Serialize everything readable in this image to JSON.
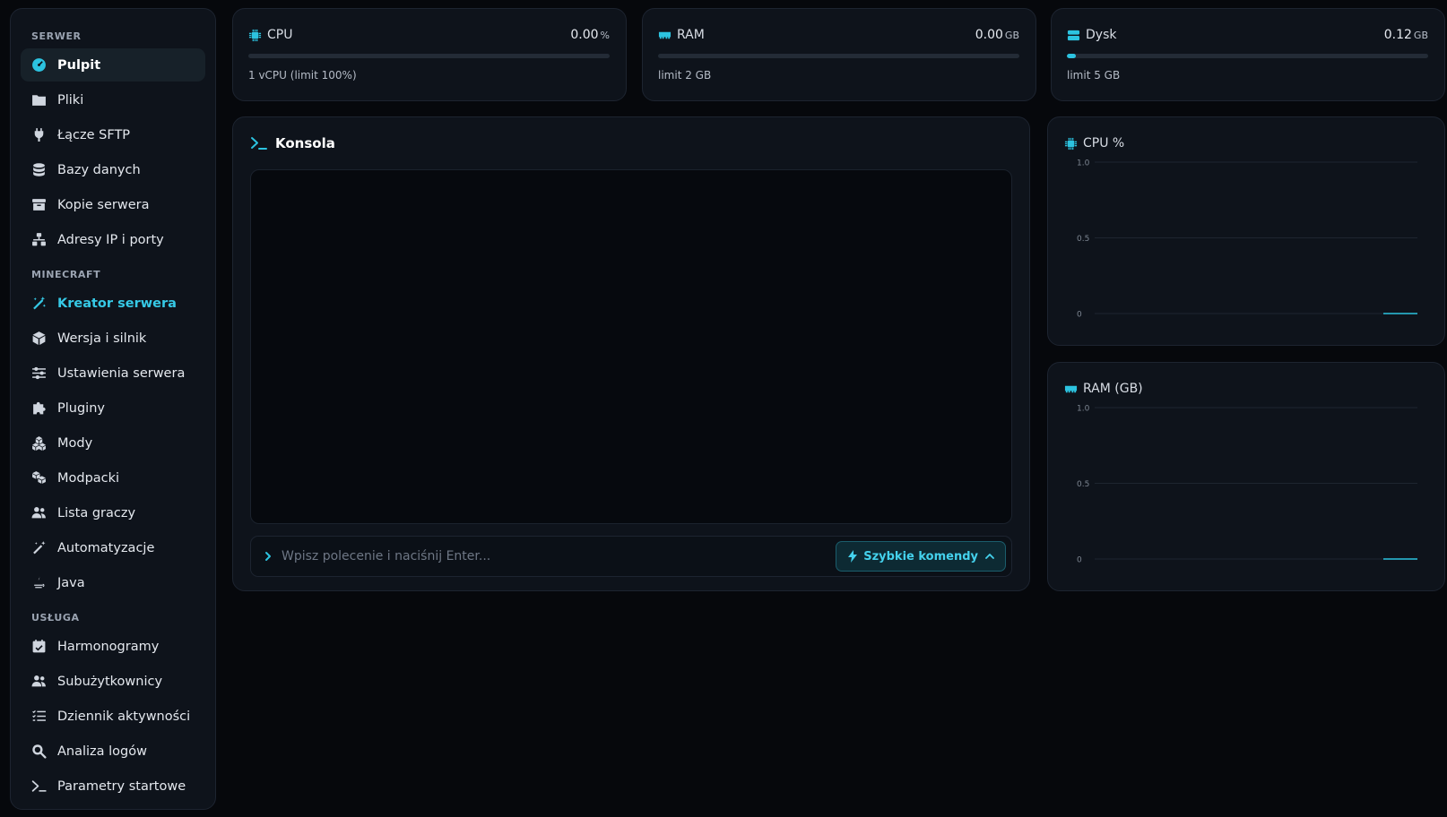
{
  "sidebar": {
    "sections": [
      {
        "label": "SERWER",
        "items": [
          {
            "label": "Pulpit",
            "icon": "dashboard-icon",
            "state": "active"
          },
          {
            "label": "Pliki",
            "icon": "folder-icon"
          },
          {
            "label": "Łącze SFTP",
            "icon": "plug-icon"
          },
          {
            "label": "Bazy danych",
            "icon": "database-icon"
          },
          {
            "label": "Kopie serwera",
            "icon": "archive-icon"
          },
          {
            "label": "Adresy IP i porty",
            "icon": "network-icon"
          }
        ]
      },
      {
        "label": "MINECRAFT",
        "items": [
          {
            "label": "Kreator serwera",
            "icon": "magic-wand-icon",
            "state": "highlight"
          },
          {
            "label": "Wersja i silnik",
            "icon": "cube-icon"
          },
          {
            "label": "Ustawienia serwera",
            "icon": "sliders-icon"
          },
          {
            "label": "Pluginy",
            "icon": "puzzle-icon"
          },
          {
            "label": "Mody",
            "icon": "cubes-icon"
          },
          {
            "label": "Modpacki",
            "icon": "boxes-icon"
          },
          {
            "label": "Lista graczy",
            "icon": "users-icon"
          },
          {
            "label": "Automatyzacje",
            "icon": "wand-icon"
          },
          {
            "label": "Java",
            "icon": "java-icon"
          }
        ]
      },
      {
        "label": "USŁUGA",
        "items": [
          {
            "label": "Harmonogramy",
            "icon": "calendar-check-icon"
          },
          {
            "label": "Subużytkownicy",
            "icon": "users-icon"
          },
          {
            "label": "Dziennik aktywności",
            "icon": "list-icon"
          },
          {
            "label": "Analiza logów",
            "icon": "search-icon"
          },
          {
            "label": "Parametry startowe",
            "icon": "terminal-icon"
          }
        ]
      }
    ]
  },
  "stats": {
    "cpu": {
      "title": "CPU",
      "value": "0.00",
      "unit": "%",
      "sub": "1 vCPU (limit 100%)",
      "fill_percent": 0
    },
    "ram": {
      "title": "RAM",
      "value": "0.00",
      "unit": "GB",
      "sub": "limit 2 GB",
      "fill_percent": 0
    },
    "disk": {
      "title": "Dysk",
      "value": "0.12",
      "unit": "GB",
      "sub": "limit 5 GB",
      "fill_percent": 2.4
    }
  },
  "console": {
    "title": "Konsola",
    "placeholder": "Wpisz polecenie i naciśnij Enter...",
    "quick_button": "Szybkie komendy"
  },
  "colors": {
    "accent": "#2cc3e0",
    "background": "#06080c",
    "card": "#0e131b"
  },
  "chart_data": [
    {
      "type": "line",
      "title": "CPU %",
      "y_ticks": [
        "1.0",
        "0.5",
        "0"
      ],
      "ylim": [
        0,
        1
      ],
      "grid": true,
      "series": [
        {
          "values": [
            0,
            0
          ]
        }
      ]
    },
    {
      "type": "line",
      "title": "RAM (GB)",
      "y_ticks": [
        "1.0",
        "0.5",
        "0"
      ],
      "ylim": [
        0,
        1
      ],
      "grid": true,
      "series": [
        {
          "values": [
            0,
            0
          ]
        }
      ]
    }
  ]
}
